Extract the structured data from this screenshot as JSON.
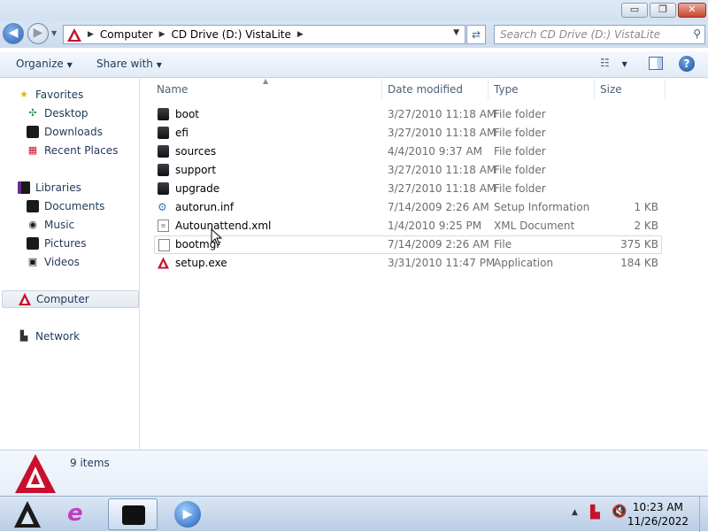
{
  "window": {
    "minimize_glyph": "▭",
    "maximize_glyph": "❐",
    "close_glyph": "✕"
  },
  "address": {
    "segments": [
      "Computer",
      "CD Drive (D:) VistaLite"
    ],
    "search_placeholder": "Search CD Drive (D:) VistaLite"
  },
  "toolbar": {
    "organize_label": "Organize",
    "share_label": "Share with"
  },
  "nav": {
    "favorites": "Favorites",
    "desktop": "Desktop",
    "downloads": "Downloads",
    "recent": "Recent Places",
    "libraries": "Libraries",
    "documents": "Documents",
    "music": "Music",
    "pictures": "Pictures",
    "videos": "Videos",
    "computer": "Computer",
    "network": "Network"
  },
  "columns": {
    "name": "Name",
    "date": "Date modified",
    "type": "Type",
    "size": "Size"
  },
  "files": [
    {
      "name": "boot",
      "date": "3/27/2010 11:18 AM",
      "type": "File folder",
      "size": "",
      "icon": "folder-icon"
    },
    {
      "name": "efi",
      "date": "3/27/2010 11:18 AM",
      "type": "File folder",
      "size": "",
      "icon": "folder-icon"
    },
    {
      "name": "sources",
      "date": "4/4/2010 9:37 AM",
      "type": "File folder",
      "size": "",
      "icon": "folder-icon"
    },
    {
      "name": "support",
      "date": "3/27/2010 11:18 AM",
      "type": "File folder",
      "size": "",
      "icon": "folder-icon"
    },
    {
      "name": "upgrade",
      "date": "3/27/2010 11:18 AM",
      "type": "File folder",
      "size": "",
      "icon": "folder-icon"
    },
    {
      "name": "autorun.inf",
      "date": "7/14/2009 2:26 AM",
      "type": "Setup Information",
      "size": "1 KB",
      "icon": "setup-info-icon"
    },
    {
      "name": "Autounattend.xml",
      "date": "1/4/2010 9:25 PM",
      "type": "XML Document",
      "size": "2 KB",
      "icon": "xml-icon"
    },
    {
      "name": "bootmgr",
      "date": "7/14/2009 2:26 AM",
      "type": "File",
      "size": "375 KB",
      "icon": "file-icon"
    },
    {
      "name": "setup.exe",
      "date": "3/31/2010 11:47 PM",
      "type": "Application",
      "size": "184 KB",
      "icon": "setup-exe-icon"
    }
  ],
  "status": {
    "item_count": "9 items"
  },
  "taskbar": {
    "time": "10:23 AM",
    "date": "11/26/2022"
  },
  "colors": {
    "accent": "#c8102e",
    "selection": "#e3e9f0",
    "folder": "#1a1a1a"
  }
}
